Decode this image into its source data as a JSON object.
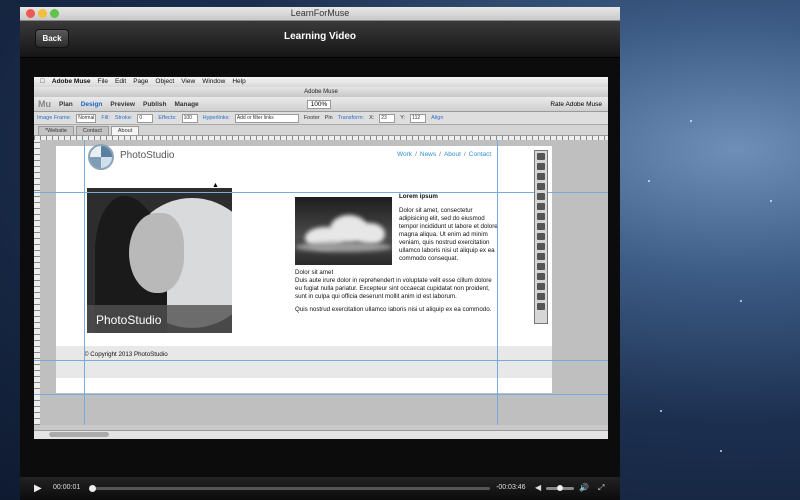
{
  "window": {
    "title": "LearnForMuse"
  },
  "navbar": {
    "back_label": "Back",
    "title": "Learning Video"
  },
  "muse": {
    "menu": [
      "Adobe Muse",
      "File",
      "Edit",
      "Page",
      "Object",
      "View",
      "Window",
      "Help"
    ],
    "window_title": "Adobe Muse",
    "logo": "Mu",
    "tabs": [
      "Plan",
      "Design",
      "Preview",
      "Publish",
      "Manage"
    ],
    "active_tab": "Design",
    "zoom": "100%",
    "rate": "Rate Adobe Muse",
    "control_bar": {
      "image_frame": "Image Frame:",
      "image_frame_value": "Normal",
      "fill": "Fill:",
      "stroke": "Stroke:",
      "stroke_value": "0",
      "effects": "Effects:",
      "effects_value": "100",
      "hyperlinks": "Hyperlinks:",
      "hyperlinks_value": "Add or filter links",
      "footer": "Footer",
      "pin": "Pin",
      "transform": "Transform:",
      "x_label": "X:",
      "x_value": "23",
      "y_label": "Y:",
      "y_value": "112",
      "align": "Align"
    },
    "page_tabs": [
      "*Website",
      "Contact",
      "About"
    ],
    "active_page_tab": "About"
  },
  "site": {
    "brand": "PhotoStudio",
    "nav": [
      "Work",
      "News",
      "About",
      "Contact"
    ],
    "hero_caption": "PhotoStudio",
    "heading": "Lorem ipsum",
    "para1": "Dolor sit amet, consectetur adipisicing elit, sed do eiusmod tempor incididunt ut labore et dolore magna aliqua. Ut enim ad minim veniam, quis nostrud exercitation ullamco laboris nisi ut aliquip ex ea commodo consequat.",
    "para2_title": "Dolor sit amet",
    "para2": "Duis aute irure dolor in reprehendert in voluptate velit esse cillum dolore eu fugiat nulla pariatur. Excepteur sint occaecat cupidatat non proident, sunt in culpa qui officia deserunt mollit anim id est laborum.",
    "para3": "Quis nostrud exercitation ullamco laboris nisi ut aliquip ex ea commodo.",
    "copyright": "© Copyright 2013 PhotoStudio"
  },
  "player": {
    "elapsed": "00:00:01",
    "remaining": "-00:03:46",
    "progress": 0.005,
    "volume": 0.5
  },
  "icons": [
    "apple-icon",
    "play-icon",
    "volume-low-icon",
    "volume-high-icon",
    "fullscreen-icon",
    "cursor-icon"
  ]
}
